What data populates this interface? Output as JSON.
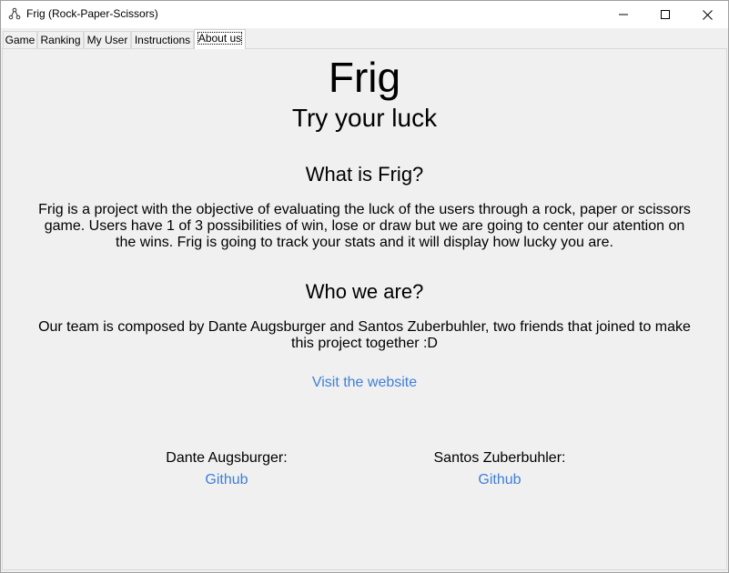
{
  "window": {
    "title": "Frig (Rock-Paper-Scissors)",
    "minimize_icon": "minimize-icon",
    "maximize_icon": "maximize-icon",
    "close_icon": "close-icon"
  },
  "tabs": [
    {
      "label": "Game"
    },
    {
      "label": "Ranking"
    },
    {
      "label": "My User"
    },
    {
      "label": "Instructions"
    },
    {
      "label": "About us",
      "active": true
    }
  ],
  "about": {
    "title": "Frig",
    "subtitle": "Try your luck",
    "section1_heading": "What is Frig?",
    "section1_text": "Frig is a project with the objective of evaluating the luck of the users through a rock, paper or scissors game. Users have 1 of 3 possibilities of win, lose or draw but we are going to center our atention on the wins. Frig is going to track your stats and it will display how lucky you are.",
    "section2_heading": "Who we are?",
    "section2_text": "Our team is composed by Dante Augsburger and Santos Zuberbuhler, two friends that joined to make this project together :D",
    "website_link": "Visit the website",
    "members": [
      {
        "name": "Dante Augsburger:",
        "link": "Github"
      },
      {
        "name": "Santos Zuberbuhler:",
        "link": "Github"
      }
    ],
    "link_color": "#3f7fd8"
  }
}
